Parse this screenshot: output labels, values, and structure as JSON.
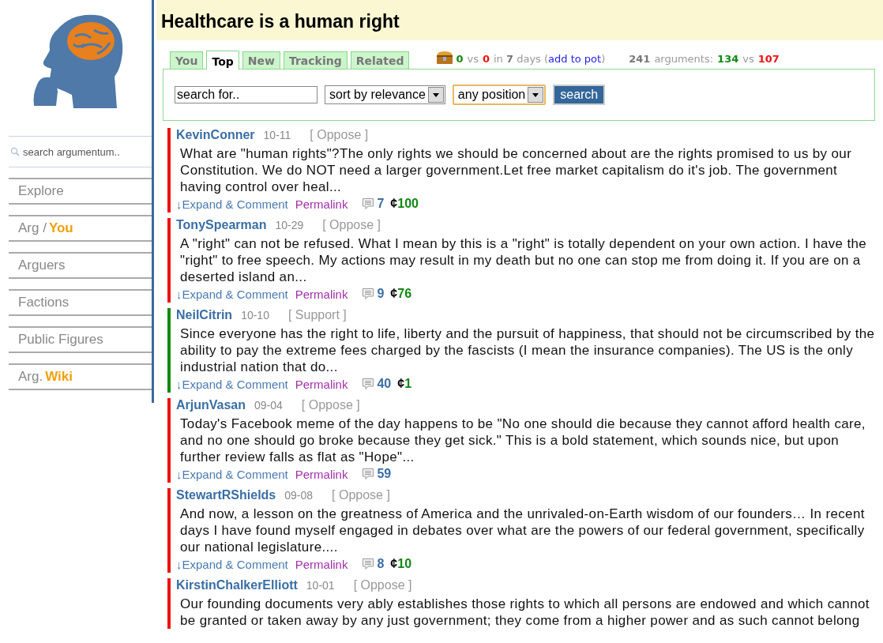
{
  "sidebar": {
    "search": {
      "placeholder": "search argumentum.."
    },
    "items": [
      {
        "label": "Explore"
      },
      {
        "label": "Arg /",
        "accent": "You"
      },
      {
        "label": "Arguers"
      },
      {
        "label": "Factions"
      },
      {
        "label": "Public Figures"
      },
      {
        "label": "Arg.",
        "accent": "Wiki"
      }
    ]
  },
  "title": "Healthcare is a human right",
  "tabs": [
    {
      "label": "You",
      "selected": false
    },
    {
      "label": "Top",
      "selected": true
    },
    {
      "label": "New",
      "selected": false
    },
    {
      "label": "Tracking",
      "selected": false
    },
    {
      "label": "Related",
      "selected": false
    }
  ],
  "pot": {
    "for": "0",
    "vs": "vs",
    "against": "0",
    "period": "in **7** days (",
    "link": "add to pot",
    "close": ")"
  },
  "count_line": [
    {
      "kind": "bold",
      "text": "241"
    },
    {
      "kind": "plain",
      "text": "arguments:"
    },
    {
      "kind": "for",
      "text": "134"
    },
    {
      "kind": "plain",
      "text": "vs"
    },
    {
      "kind": "against",
      "text": "107"
    }
  ],
  "filters": {
    "search": {
      "value": "search for.."
    },
    "sort": "sort by relevance",
    "position": "any position",
    "button": "search"
  },
  "posts": [
    {
      "author": "KevinConner",
      "date": "10-11",
      "position": "[ Oppose ]",
      "color": "#ee1111",
      "body": "What are \"human rights\"?The only rights we should be concerned about are the rights promised to us by our Constitution. We do NOT need a larger government.Let free market capitalism do it's job. The government having control over heal...",
      "expand": "↓Expand & Comment",
      "permalink": "Permalink",
      "comments": "7",
      "pot": {
        "symbol": "¢",
        "amount": "100"
      }
    },
    {
      "author": "TonySpearman",
      "date": "10-29",
      "position": "[ Oppose ]",
      "color": "#ee1111",
      "body": "A \"right\" can not be refused. What I mean by this is a \"right\" is totally dependent on your own action. I have the \"right\" to free speech. My actions may result in my death but no one can stop me from doing it. If you are on a deserted island an...",
      "expand": "↓Expand & Comment",
      "permalink": "Permalink",
      "comments": "9",
      "pot": {
        "symbol": "¢",
        "amount": "76"
      }
    },
    {
      "author": "NeilCitrin",
      "date": "10-10",
      "position": "[ Support ]",
      "color": "#118811",
      "body": "Since everyone has the right to life, liberty and the pursuit of happiness, that should not be circumscribed by the ability to pay the extreme fees charged by the fascists (I mean the insurance companies). The US is the only industrial nation that do...",
      "expand": "↓Expand & Comment",
      "permalink": "Permalink",
      "comments": "40",
      "pot": {
        "symbol": "¢",
        "amount": "1"
      }
    },
    {
      "author": "ArjunVasan",
      "date": "09-04",
      "position": "[ Oppose ]",
      "color": "#ee1111",
      "body": "Today's Facebook meme of the day happens to be \"No one should die because they cannot afford health care, and no one should go broke because they get sick.\" This is a bold statement, which sounds nice, but upon further review falls as flat as \"Hope\"...",
      "expand": "↓Expand & Comment",
      "permalink": "Permalink",
      "comments": "59"
    },
    {
      "author": "StewartRShields",
      "date": "09-08",
      "position": "[ Oppose ]",
      "color": "#ee1111",
      "body": "And now, a lesson on the greatness of America and the unrivaled-on-Earth wisdom of our founders… In recent days I have found myself engaged in debates over what are the powers of our federal government, specifically our national legislature....",
      "expand": "↓Expand & Comment",
      "permalink": "Permalink",
      "comments": "8",
      "pot": {
        "symbol": "¢",
        "amount": "10"
      }
    },
    {
      "author": "KirstinChalkerElliott",
      "date": "10-01",
      "position": "[ Oppose ]",
      "color": "#ee1111",
      "body": "Our founding documents very ably establishes those rights to which all persons are endowed and which cannot be granted or taken away by any just government; they come from a higher power and as such cannot belong"
    }
  ]
}
